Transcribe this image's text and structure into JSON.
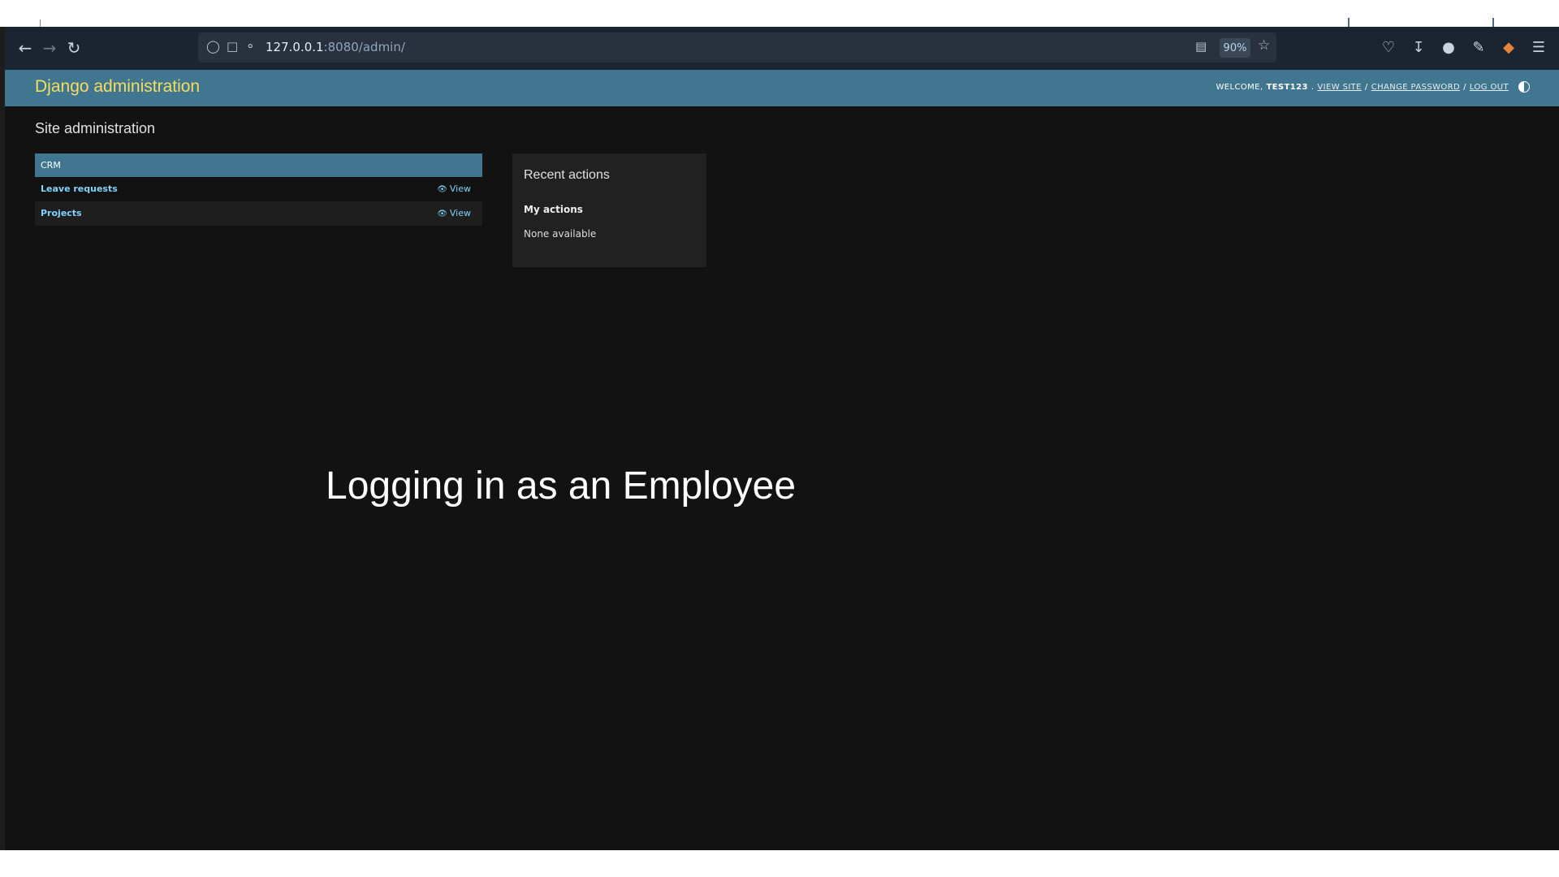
{
  "browser": {
    "url_host": "127.0.0.1",
    "url_rest": ":8080/admin/",
    "zoom": "90%"
  },
  "header": {
    "brand": "Django administration",
    "welcome_prefix": "WELCOME,",
    "username": "TEST123",
    "view_site": "VIEW SITE",
    "change_password": "CHANGE PASSWORD",
    "log_out": "LOG OUT",
    "separator": "/"
  },
  "main": {
    "title": "Site administration",
    "module": {
      "caption": "CRM",
      "rows": [
        {
          "name": "Leave requests",
          "action": "View"
        },
        {
          "name": "Projects",
          "action": "View"
        }
      ]
    }
  },
  "recent_actions": {
    "title": "Recent actions",
    "subtitle": "My actions",
    "empty": "None available"
  },
  "overlay": {
    "caption": "Logging in as an Employee"
  },
  "colors": {
    "header_bg": "#417690",
    "brand": "#f5dd5d",
    "link": "#81d4fa",
    "page_bg": "#121212"
  }
}
